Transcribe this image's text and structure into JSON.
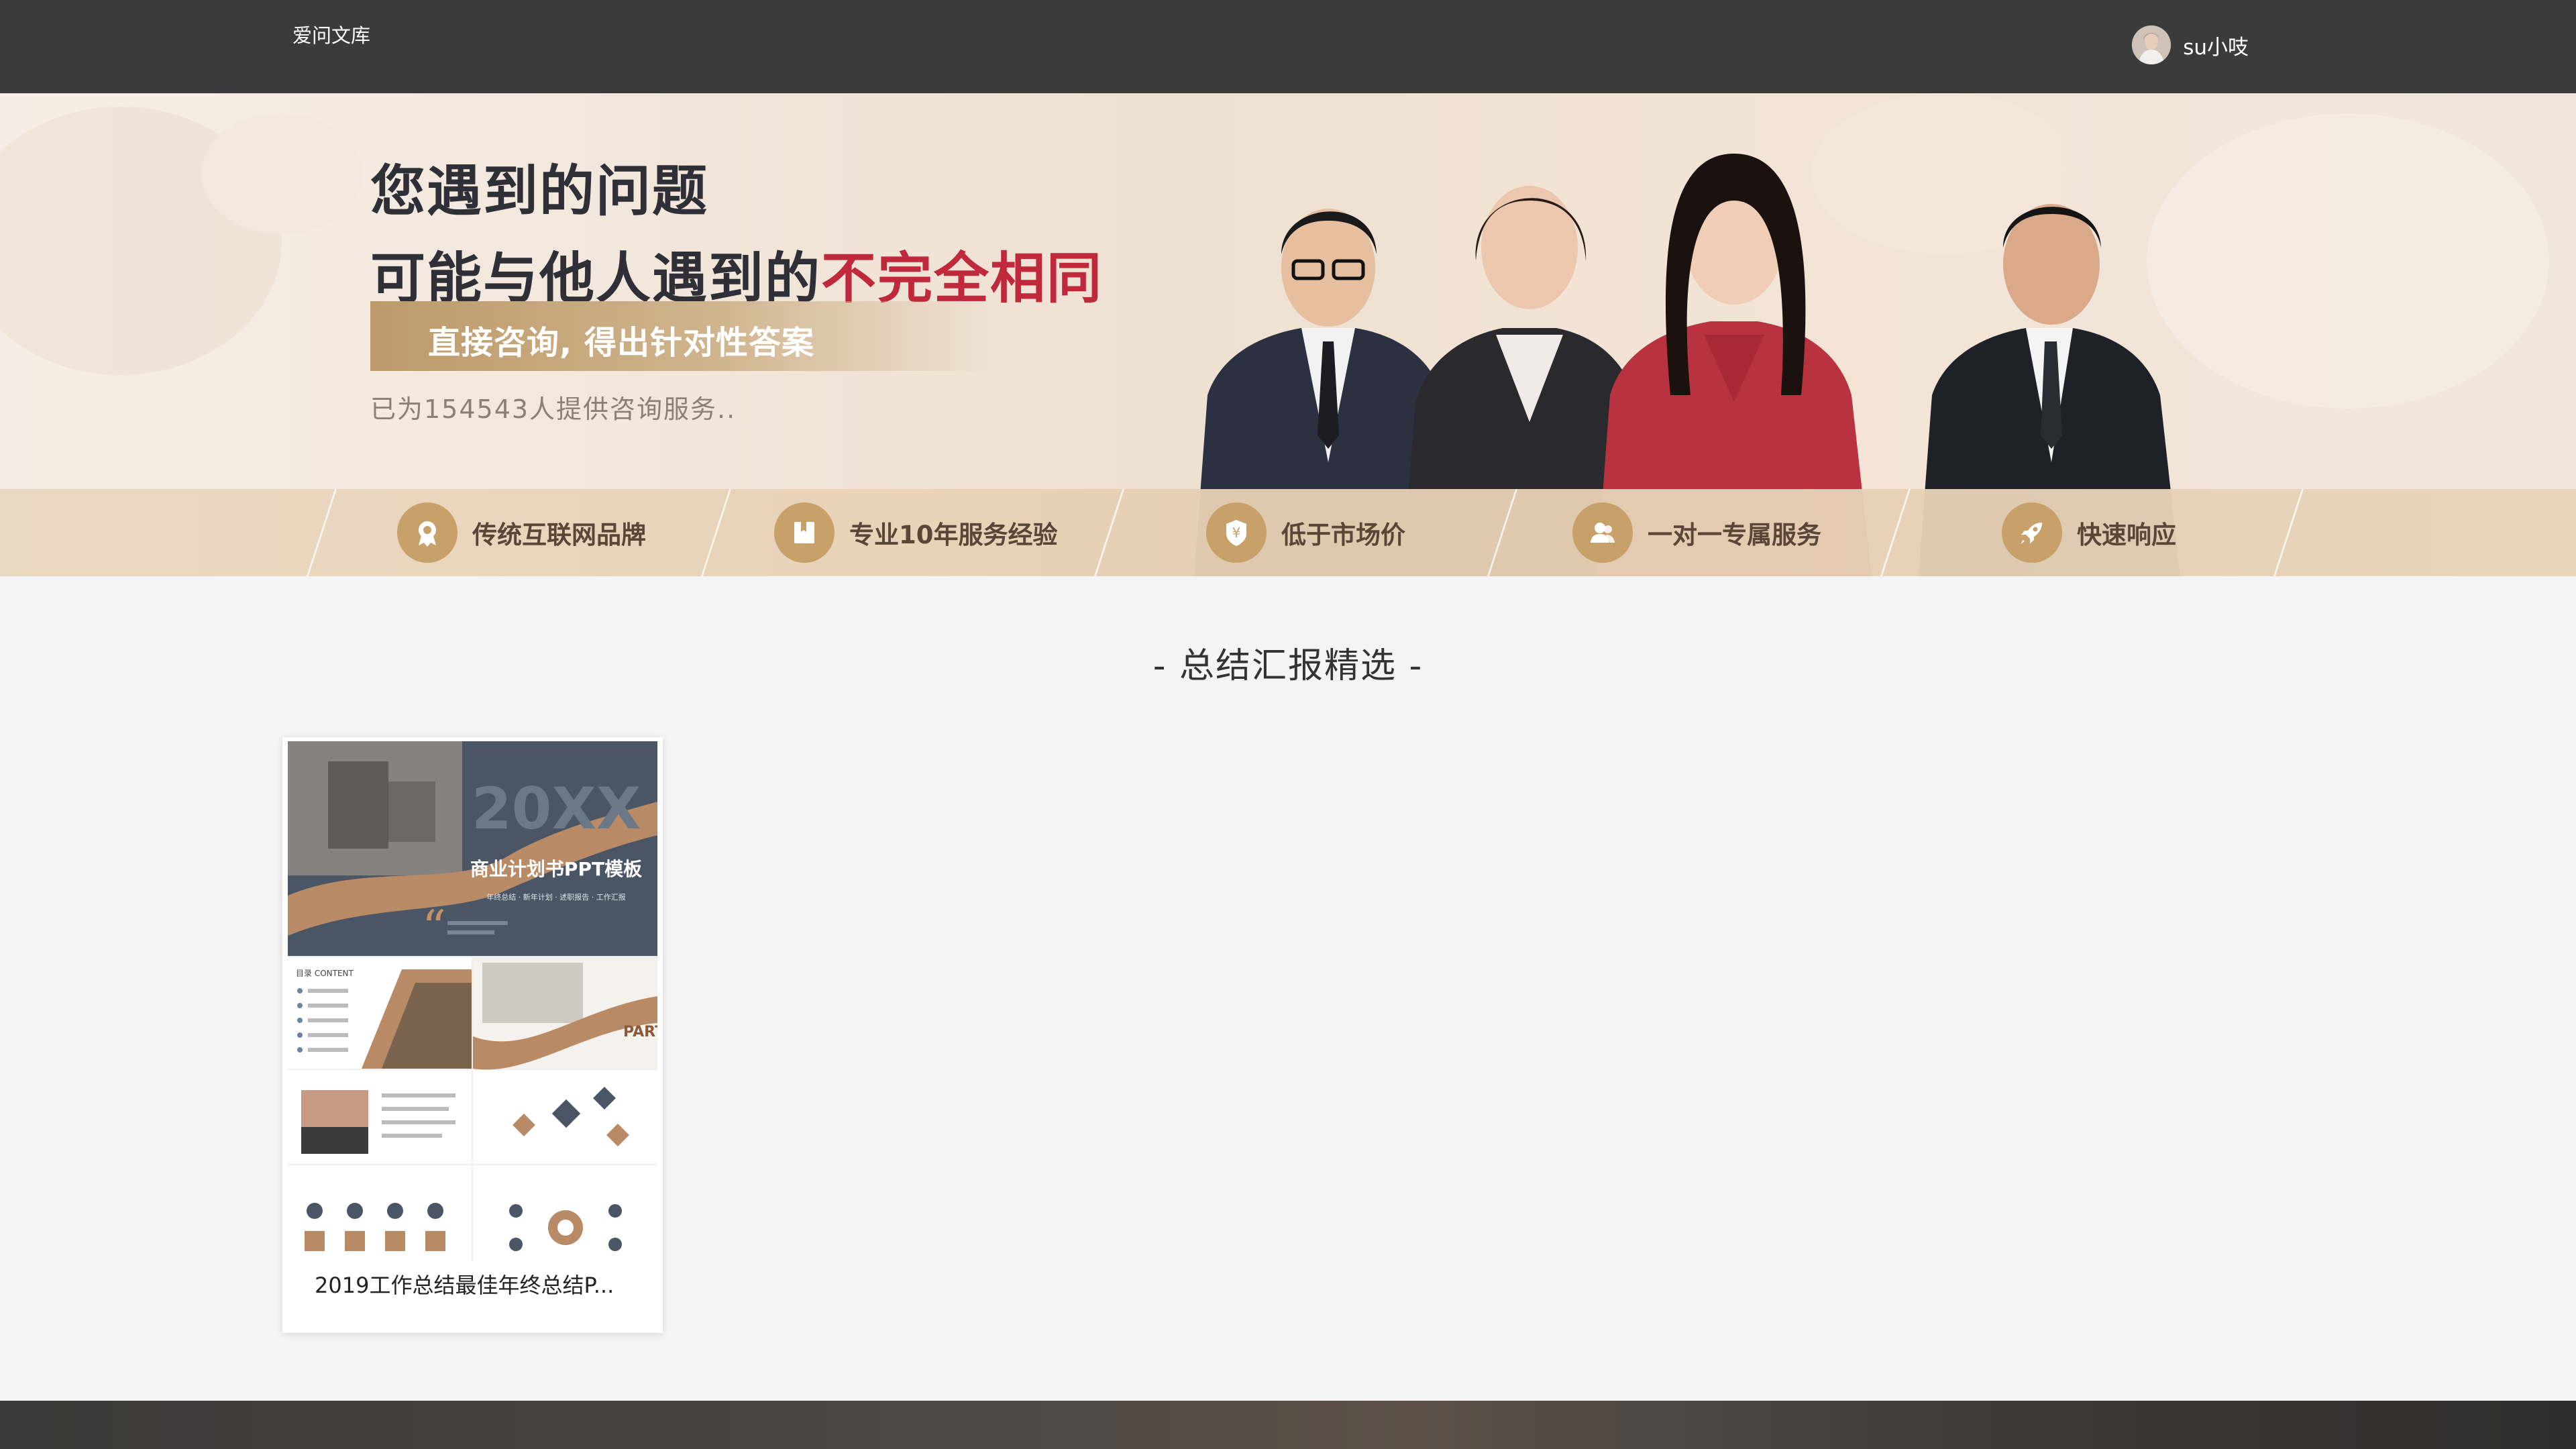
{
  "header": {
    "site_name": "爱问文库",
    "user_name": "su小吱"
  },
  "banner": {
    "headline_line1": "您遇到的问题",
    "headline_line2_prefix": "可能与他人遇到的",
    "headline_line2_accent": "不完全相同",
    "subheadline": "直接咨询, 得出针对性答案",
    "served_text": "已为154543人提供咨询服务..",
    "features": [
      {
        "icon": "badge-icon",
        "label": "传统互联网品牌"
      },
      {
        "icon": "book-icon",
        "label": "专业10年服务经验"
      },
      {
        "icon": "yen-shield-icon",
        "label": "低于市场价"
      },
      {
        "icon": "users-icon",
        "label": "一对一专属服务"
      },
      {
        "icon": "rocket-icon",
        "label": "快速响应"
      }
    ]
  },
  "section": {
    "title": "- 总结汇报精选 -"
  },
  "cards": [
    {
      "title": "2019工作总结最佳年终总结P...",
      "thumb_text": {
        "year": "20XX",
        "heading": "商业计划书PPT模板",
        "tags": "年终总结 · 新年计划 · 述职报告 · 工作汇报",
        "toc": "目录 CONTENT",
        "part": "PART"
      }
    }
  ],
  "colors": {
    "topbar": "#3b3b3b",
    "accent_red": "#c0283c",
    "gold": "#c8a06a",
    "page_bg": "#f4f4f4"
  }
}
